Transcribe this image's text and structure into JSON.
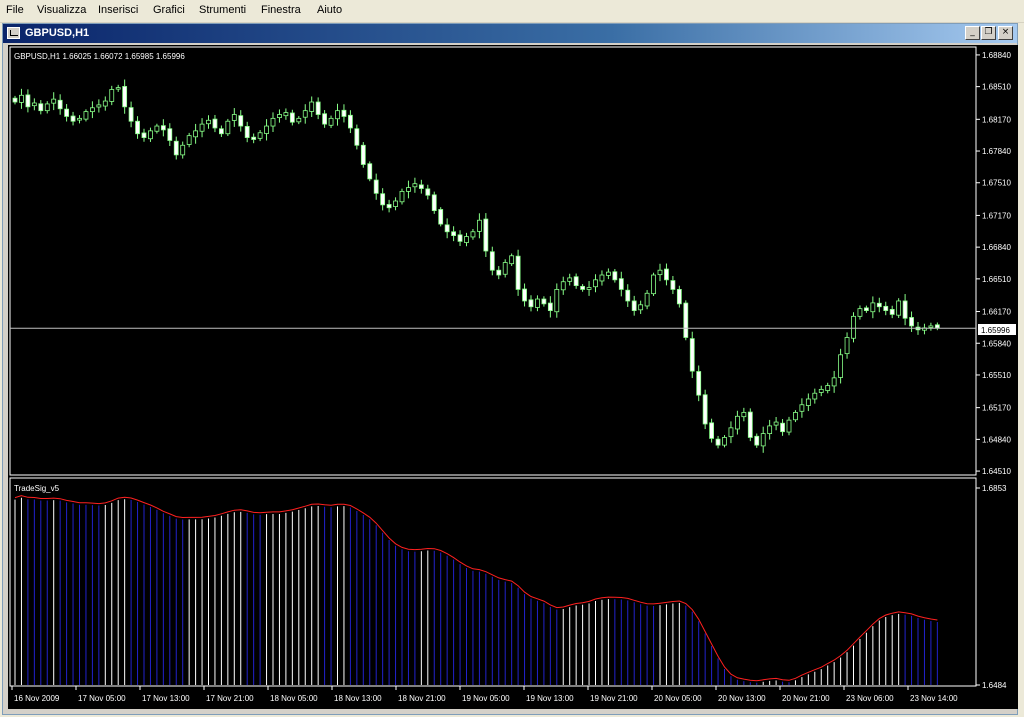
{
  "menu": [
    "File",
    "Visualizza",
    "Inserisci",
    "Grafici",
    "Strumenti",
    "Finestra",
    "Aiuto"
  ],
  "window": {
    "title": "GBPUSD,H1",
    "buttons": {
      "minimize": "_",
      "restore": "❐",
      "close": "×"
    }
  },
  "colors": {
    "background": "#000000",
    "bull": "#000000",
    "bull_outline": "#88ff88",
    "bear": "#ffffff",
    "wick": "#88ff88",
    "indicator_line": "#ff0000",
    "bar_up": "#ffffff",
    "bar_down": "#2222cc"
  },
  "main_chart": {
    "header": "GBPUSD,H1  1.66025 1.66072 1.65985 1.65996",
    "price_labels": [
      "1.68840",
      "1.68510",
      "1.68170",
      "1.67840",
      "1.67510",
      "1.67170",
      "1.66840",
      "1.66510",
      "1.66170",
      "1.65840",
      "1.65510",
      "1.65170",
      "1.64840",
      "1.64510"
    ],
    "current_price": "1.65996"
  },
  "indicator": {
    "name": "TradeSig_v5",
    "top_label": "1.6853",
    "bottom_label": "1.6484"
  },
  "time_labels": [
    "16 Nov 2009",
    "17 Nov 05:00",
    "17 Nov 13:00",
    "17 Nov 21:00",
    "18 Nov 05:00",
    "18 Nov 13:00",
    "18 Nov 21:00",
    "19 Nov 05:00",
    "19 Nov 13:00",
    "19 Nov 21:00",
    "20 Nov 05:00",
    "20 Nov 13:00",
    "20 Nov 21:00",
    "23 Nov 06:00",
    "23 Nov 14:00"
  ],
  "chart_data": {
    "type": "candlestick",
    "symbol": "GBPUSD",
    "timeframe": "H1",
    "ylim": [
      1.6451,
      1.6884
    ],
    "close_series": [
      1.6835,
      1.6842,
      1.683,
      1.6834,
      1.6826,
      1.6833,
      1.6838,
      1.6828,
      1.682,
      1.6815,
      1.6818,
      1.6825,
      1.6829,
      1.6832,
      1.6836,
      1.6848,
      1.685,
      1.683,
      1.6815,
      1.6802,
      1.6798,
      1.6805,
      1.681,
      1.6806,
      1.6795,
      1.678,
      1.679,
      1.68,
      1.6805,
      1.6812,
      1.6816,
      1.6808,
      1.6802,
      1.6815,
      1.6822,
      1.681,
      1.6798,
      1.6796,
      1.6803,
      1.681,
      1.6818,
      1.6822,
      1.6824,
      1.6814,
      1.6818,
      1.6826,
      1.6835,
      1.6822,
      1.6812,
      1.6818,
      1.6826,
      1.682,
      1.6808,
      1.679,
      1.677,
      1.6755,
      1.674,
      1.6728,
      1.6725,
      1.6732,
      1.6742,
      1.6746,
      1.675,
      1.6745,
      1.6738,
      1.6722,
      1.6708,
      1.67,
      1.6696,
      1.669,
      1.6695,
      1.67,
      1.6712,
      1.668,
      1.666,
      1.6655,
      1.6668,
      1.6675,
      1.664,
      1.6628,
      1.6622,
      1.663,
      1.6625,
      1.6618,
      1.664,
      1.6648,
      1.6652,
      1.6644,
      1.664,
      1.6642,
      1.665,
      1.6655,
      1.6658,
      1.665,
      1.664,
      1.6628,
      1.6618,
      1.6624,
      1.6636,
      1.6655,
      1.666,
      1.665,
      1.664,
      1.6625,
      1.659,
      1.6555,
      1.653,
      1.65,
      1.6485,
      1.6478,
      1.6486,
      1.6496,
      1.6508,
      1.6512,
      1.6486,
      1.6478,
      1.649,
      1.6498,
      1.6502,
      1.6492,
      1.6504,
      1.6512,
      1.652,
      1.6526,
      1.6532,
      1.6536,
      1.654,
      1.6548,
      1.6572,
      1.659,
      1.6612,
      1.662,
      1.6618,
      1.6626,
      1.6622,
      1.6618,
      1.6614,
      1.6628,
      1.661,
      1.6602,
      1.6598,
      1.66,
      1.6602,
      1.66
    ]
  }
}
